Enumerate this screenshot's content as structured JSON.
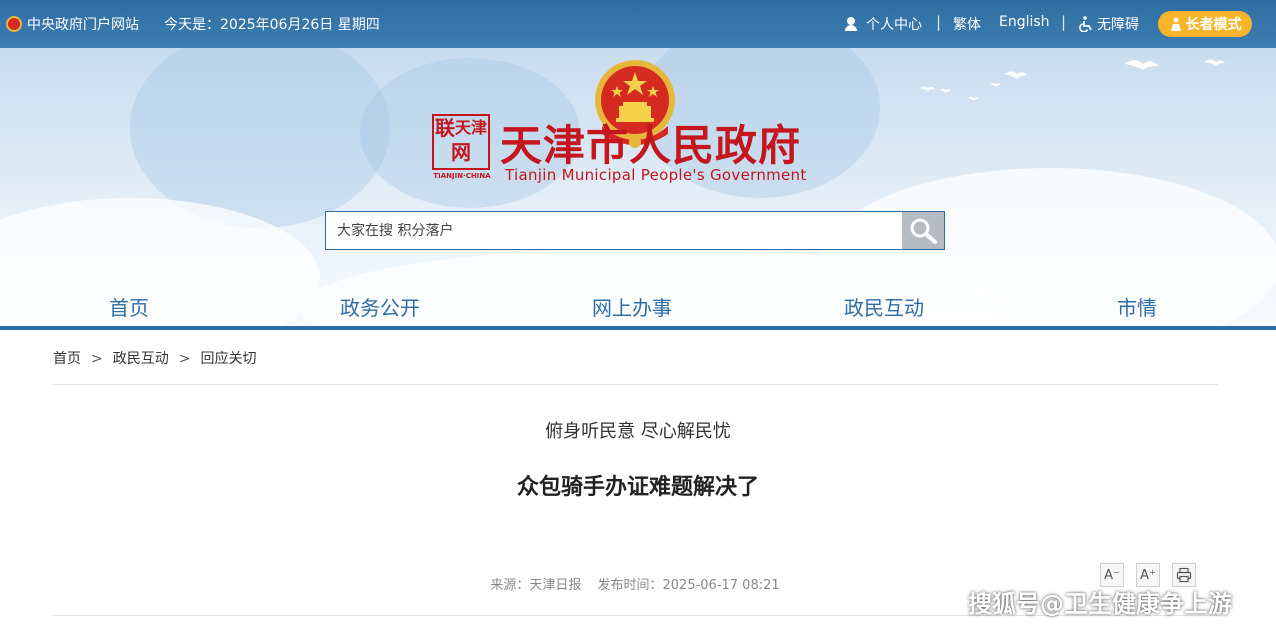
{
  "topbar": {
    "gov_portal": "中央政府门户网站",
    "date_text": "今天是：2025年06月26日 星期四",
    "personal_center": "个人中心",
    "sep": "|",
    "traditional": "繁体",
    "english": "English",
    "accessibility": "无障碍",
    "elder_mode": "长者模式"
  },
  "header": {
    "seal_text": [
      "天津",
      "联",
      "网",
      "TIANJIN·CHINA"
    ],
    "title": "天津市人民政府",
    "subtitle": "Tianjin Municipal People's Government"
  },
  "search": {
    "placeholder": "大家在搜 积分落户"
  },
  "nav": {
    "items": [
      "首页",
      "政务公开",
      "网上办事",
      "政民互动",
      "市情"
    ]
  },
  "breadcrumb": {
    "items": [
      "首页",
      "政民互动",
      "回应关切"
    ],
    "sep": ">"
  },
  "article": {
    "subtitle": "俯身听民意 尽心解民忧",
    "title": "众包骑手办证难题解决了",
    "source": "来源：天津日报",
    "publish_time": "发布时间：2025-06-17 08:21"
  },
  "tools": {
    "font_smaller": "A⁻",
    "font_larger": "A⁺",
    "print_icon": "print-icon"
  },
  "watermark": "搜狐号@卫生健康争上游",
  "colors": {
    "topbar": "#2f6ea3",
    "brand_red": "#c4161c",
    "nav_blue": "#2e6ea6",
    "elder_btn": "#f6b52a"
  }
}
